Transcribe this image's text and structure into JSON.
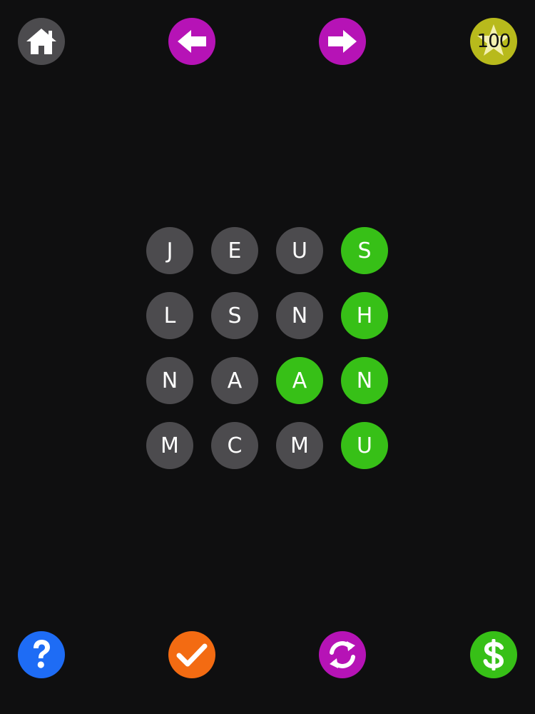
{
  "toolbar_top": {
    "home_icon": "home-icon",
    "prev_icon": "arrow-left-icon",
    "next_icon": "arrow-right-icon",
    "coins": "100",
    "coins_icon": "star-icon"
  },
  "toolbar_bottom": {
    "help_icon": "question-icon",
    "check_icon": "checkmark-icon",
    "shuffle_icon": "refresh-icon",
    "shop_icon": "dollar-icon"
  },
  "grid": {
    "rows": [
      [
        "J",
        "E",
        "U",
        "S"
      ],
      [
        "L",
        "S",
        "N",
        "H"
      ],
      [
        "N",
        "A",
        "A",
        "N"
      ],
      [
        "M",
        "C",
        "M",
        "U"
      ]
    ],
    "found": [
      [
        false,
        false,
        false,
        true
      ],
      [
        false,
        false,
        false,
        true
      ],
      [
        false,
        false,
        true,
        true
      ],
      [
        false,
        false,
        false,
        true
      ]
    ]
  },
  "colors": {
    "background": "#0f0f10",
    "tile": "#4c4b4e",
    "tile_found": "#37c017",
    "magenta": "#b613b6",
    "coin": "#b8ba1c",
    "help": "#1e6cf5",
    "check": "#f36b12"
  }
}
